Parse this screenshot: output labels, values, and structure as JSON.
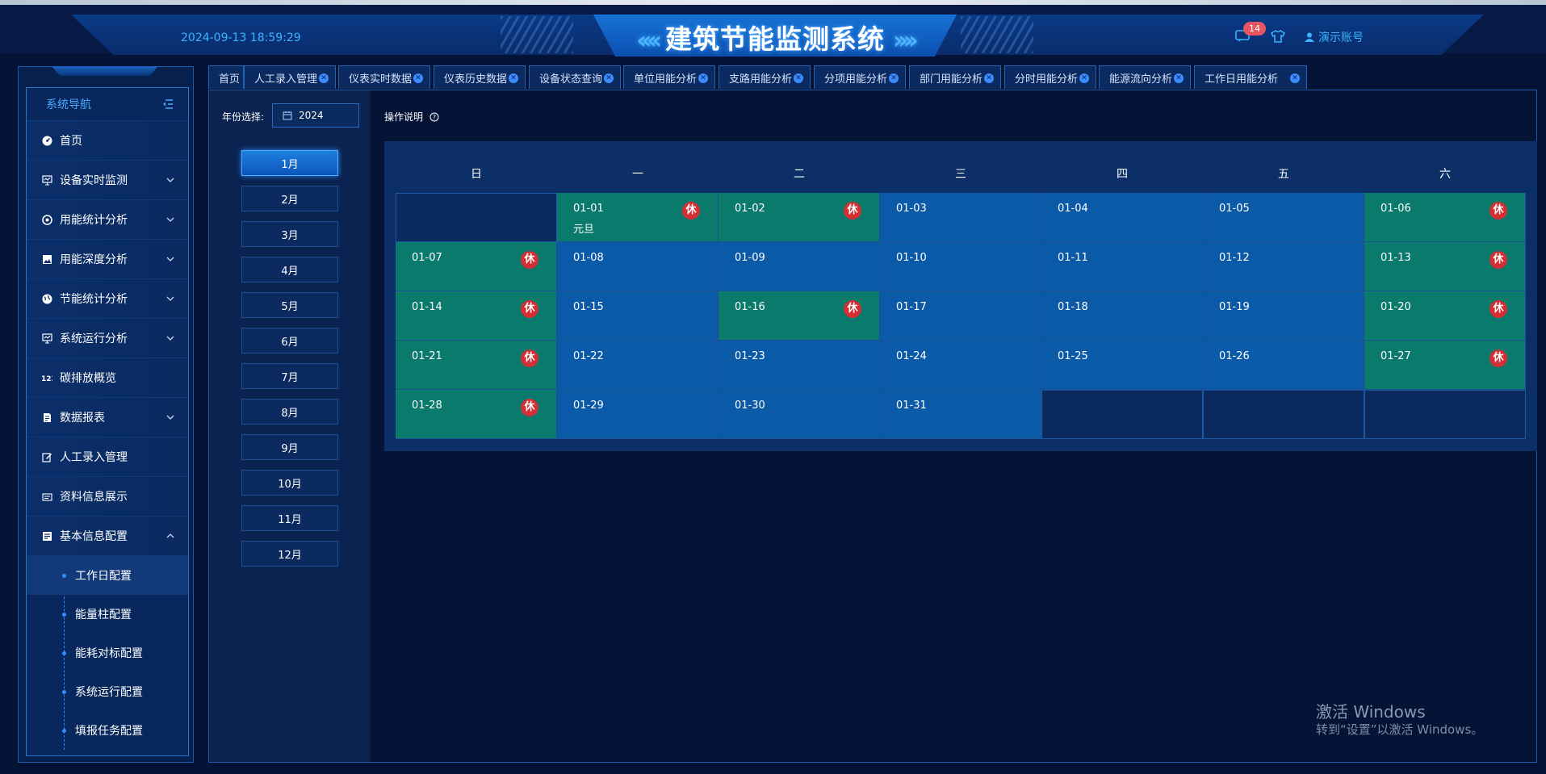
{
  "header": {
    "title": "建筑节能监测系统",
    "datetime": "2024-09-13 18:59:29",
    "message_count": "14",
    "account_label": "演示账号"
  },
  "sidebar": {
    "title": "系统导航",
    "items": [
      {
        "label": "首页",
        "icon": "dashboard-icon",
        "expandable": false
      },
      {
        "label": "设备实时监测",
        "icon": "monitor-icon",
        "expandable": true
      },
      {
        "label": "用能统计分析",
        "icon": "compass-icon",
        "expandable": true
      },
      {
        "label": "用能深度分析",
        "icon": "image-icon",
        "expandable": true
      },
      {
        "label": "节能统计分析",
        "icon": "globe-icon",
        "expandable": true
      },
      {
        "label": "系统运行分析",
        "icon": "monitor-icon",
        "expandable": true
      },
      {
        "label": "碳排放概览",
        "icon": "number-icon",
        "expandable": false
      },
      {
        "label": "数据报表",
        "icon": "document-icon",
        "expandable": true
      },
      {
        "label": "人工录入管理",
        "icon": "edit-icon",
        "expandable": false
      },
      {
        "label": "资料信息展示",
        "icon": "card-icon",
        "expandable": false
      },
      {
        "label": "基本信息配置",
        "icon": "config-icon",
        "expandable": true,
        "expanded": true
      }
    ],
    "subitems": [
      {
        "label": "工作日配置",
        "active": true
      },
      {
        "label": "能量柱配置",
        "active": false
      },
      {
        "label": "能耗对标配置",
        "active": false
      },
      {
        "label": "系统运行配置",
        "active": false
      },
      {
        "label": "填报任务配置",
        "active": false
      }
    ]
  },
  "tabs": [
    {
      "label": "首页",
      "closable": false
    },
    {
      "label": "人工录入管理",
      "closable": true
    },
    {
      "label": "仪表实时数据",
      "closable": true
    },
    {
      "label": "仪表历史数据",
      "closable": true
    },
    {
      "label": "设备状态查询",
      "closable": true
    },
    {
      "label": "单位用能分析",
      "closable": true
    },
    {
      "label": "支路用能分析",
      "closable": true
    },
    {
      "label": "分项用能分析",
      "closable": true
    },
    {
      "label": "部门用能分析",
      "closable": true
    },
    {
      "label": "分时用能分析",
      "closable": true
    },
    {
      "label": "能源流向分析",
      "closable": true
    },
    {
      "label": "工作日用能分析",
      "closable": true
    }
  ],
  "filters": {
    "year_label": "年份选择:",
    "year_value": "2024",
    "instructions_label": "操作说明"
  },
  "months": [
    "1月",
    "2月",
    "3月",
    "4月",
    "5月",
    "6月",
    "7月",
    "8月",
    "9月",
    "10月",
    "11月",
    "12月"
  ],
  "selected_month": "1月",
  "calendar": {
    "weekdays": [
      "日",
      "一",
      "二",
      "三",
      "四",
      "五",
      "六"
    ],
    "rest_label": "休",
    "cells": [
      {
        "date": "",
        "type": "empty"
      },
      {
        "date": "01-01",
        "type": "rest",
        "note": "元旦"
      },
      {
        "date": "01-02",
        "type": "rest"
      },
      {
        "date": "01-03",
        "type": "work"
      },
      {
        "date": "01-04",
        "type": "work"
      },
      {
        "date": "01-05",
        "type": "work"
      },
      {
        "date": "01-06",
        "type": "rest"
      },
      {
        "date": "01-07",
        "type": "rest"
      },
      {
        "date": "01-08",
        "type": "work"
      },
      {
        "date": "01-09",
        "type": "work"
      },
      {
        "date": "01-10",
        "type": "work"
      },
      {
        "date": "01-11",
        "type": "work"
      },
      {
        "date": "01-12",
        "type": "work"
      },
      {
        "date": "01-13",
        "type": "rest"
      },
      {
        "date": "01-14",
        "type": "rest"
      },
      {
        "date": "01-15",
        "type": "work"
      },
      {
        "date": "01-16",
        "type": "rest"
      },
      {
        "date": "01-17",
        "type": "work"
      },
      {
        "date": "01-18",
        "type": "work"
      },
      {
        "date": "01-19",
        "type": "work"
      },
      {
        "date": "01-20",
        "type": "rest"
      },
      {
        "date": "01-21",
        "type": "rest"
      },
      {
        "date": "01-22",
        "type": "work"
      },
      {
        "date": "01-23",
        "type": "work"
      },
      {
        "date": "01-24",
        "type": "work"
      },
      {
        "date": "01-25",
        "type": "work"
      },
      {
        "date": "01-26",
        "type": "work"
      },
      {
        "date": "01-27",
        "type": "rest"
      },
      {
        "date": "01-28",
        "type": "rest"
      },
      {
        "date": "01-29",
        "type": "work"
      },
      {
        "date": "01-30",
        "type": "work"
      },
      {
        "date": "01-31",
        "type": "work"
      },
      {
        "date": "",
        "type": "empty"
      },
      {
        "date": "",
        "type": "empty"
      },
      {
        "date": "",
        "type": "empty"
      }
    ]
  },
  "watermark": {
    "line1": "激活 Windows",
    "line2": "转到“设置”以激活 Windows。"
  },
  "colors": {
    "background": "#041437",
    "work_day": "#0b5aa8",
    "rest_day": "#0a7a6c",
    "rest_badge": "#d42f34",
    "accent": "#3db3ff"
  }
}
